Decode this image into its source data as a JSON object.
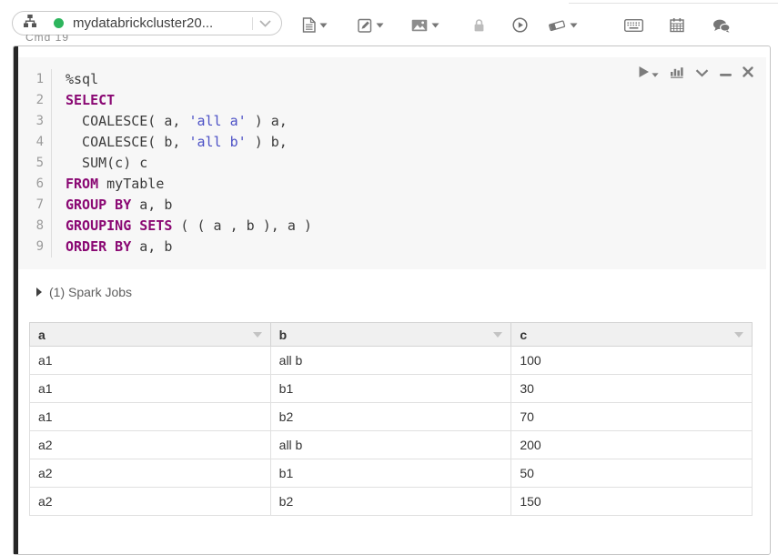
{
  "colors": {
    "keyword": "#8a0873",
    "string": "#4c51c6",
    "status_green": "#2db55d"
  },
  "toolbar": {
    "cluster": {
      "name": "mydatabrickcluster20...",
      "status_color_hex": "#2db55d"
    },
    "icon_names": [
      "cluster-tree-icon",
      "chevron-down-icon",
      "document-icon",
      "pencil-square-icon",
      "image-icon",
      "lock-icon",
      "play-circle-icon",
      "eraser-icon",
      "keyboard-icon",
      "calendar-icon",
      "chat-icon"
    ]
  },
  "cmd_label": "Cmd 19",
  "cell": {
    "actions": {
      "icon_names": [
        "run-cell-icon",
        "chart-icon",
        "collapse-chevron-icon",
        "minimize-icon",
        "close-icon"
      ]
    },
    "code": {
      "lines": [
        {
          "num": "1",
          "tokens": [
            [
              "plain",
              "%sql"
            ]
          ]
        },
        {
          "num": "2",
          "tokens": [
            [
              "keyword",
              "SELECT"
            ]
          ]
        },
        {
          "num": "3",
          "tokens": [
            [
              "plain",
              "  COALESCE( a, "
            ],
            [
              "string",
              "'all a'"
            ],
            [
              "plain",
              " ) a,"
            ]
          ]
        },
        {
          "num": "4",
          "tokens": [
            [
              "plain",
              "  COALESCE( b, "
            ],
            [
              "string",
              "'all b'"
            ],
            [
              "plain",
              " ) b,"
            ]
          ]
        },
        {
          "num": "5",
          "tokens": [
            [
              "plain",
              "  SUM(c) c"
            ]
          ]
        },
        {
          "num": "6",
          "tokens": [
            [
              "keyword",
              "FROM"
            ],
            [
              "plain",
              " myTable"
            ]
          ]
        },
        {
          "num": "7",
          "tokens": [
            [
              "keyword",
              "GROUP BY"
            ],
            [
              "plain",
              " a, b"
            ]
          ]
        },
        {
          "num": "8",
          "tokens": [
            [
              "keyword",
              "GROUPING SETS"
            ],
            [
              "plain",
              " ( ( a , b ), a )"
            ]
          ]
        },
        {
          "num": "9",
          "tokens": [
            [
              "keyword",
              "ORDER BY"
            ],
            [
              "plain",
              " a, b"
            ]
          ]
        }
      ]
    },
    "spark_jobs_label": "(1) Spark Jobs",
    "results": {
      "columns": [
        "a",
        "b",
        "c"
      ],
      "rows": [
        [
          "a1",
          "all b",
          "100"
        ],
        [
          "a1",
          "b1",
          "30"
        ],
        [
          "a1",
          "b2",
          "70"
        ],
        [
          "a2",
          "all b",
          "200"
        ],
        [
          "a2",
          "b1",
          "50"
        ],
        [
          "a2",
          "b2",
          "150"
        ]
      ]
    }
  }
}
